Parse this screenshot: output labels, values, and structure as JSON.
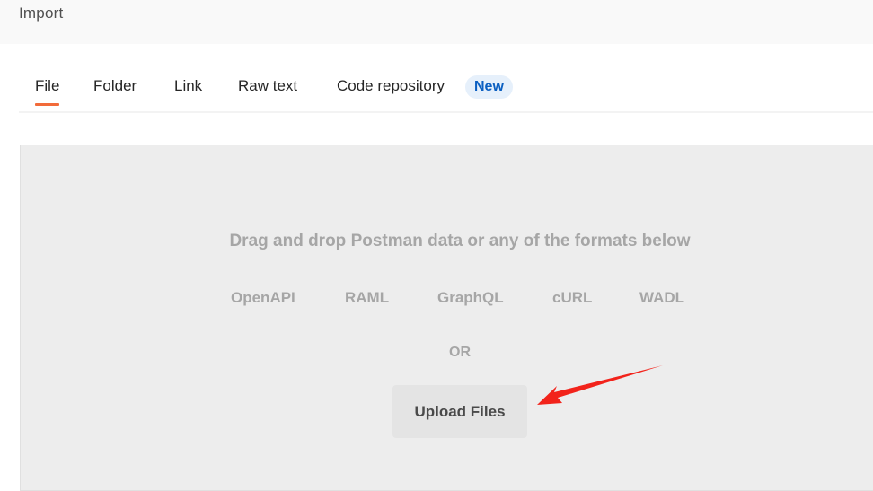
{
  "header": {
    "title": "Import"
  },
  "tabs": [
    {
      "label": "File"
    },
    {
      "label": "Folder"
    },
    {
      "label": "Link"
    },
    {
      "label": "Raw text"
    },
    {
      "label": "Code repository"
    }
  ],
  "tab_badge": "New",
  "dropzone": {
    "title": "Drag and drop Postman data or any of the formats below",
    "formats": [
      "OpenAPI",
      "RAML",
      "GraphQL",
      "cURL",
      "WADL"
    ],
    "or_text": "OR",
    "upload_label": "Upload Files"
  },
  "colors": {
    "active_tab_underline": "#f26b3a",
    "badge_bg": "#e6f0fb",
    "badge_text": "#0b5fc1",
    "annotation_arrow": "#f2231b"
  }
}
